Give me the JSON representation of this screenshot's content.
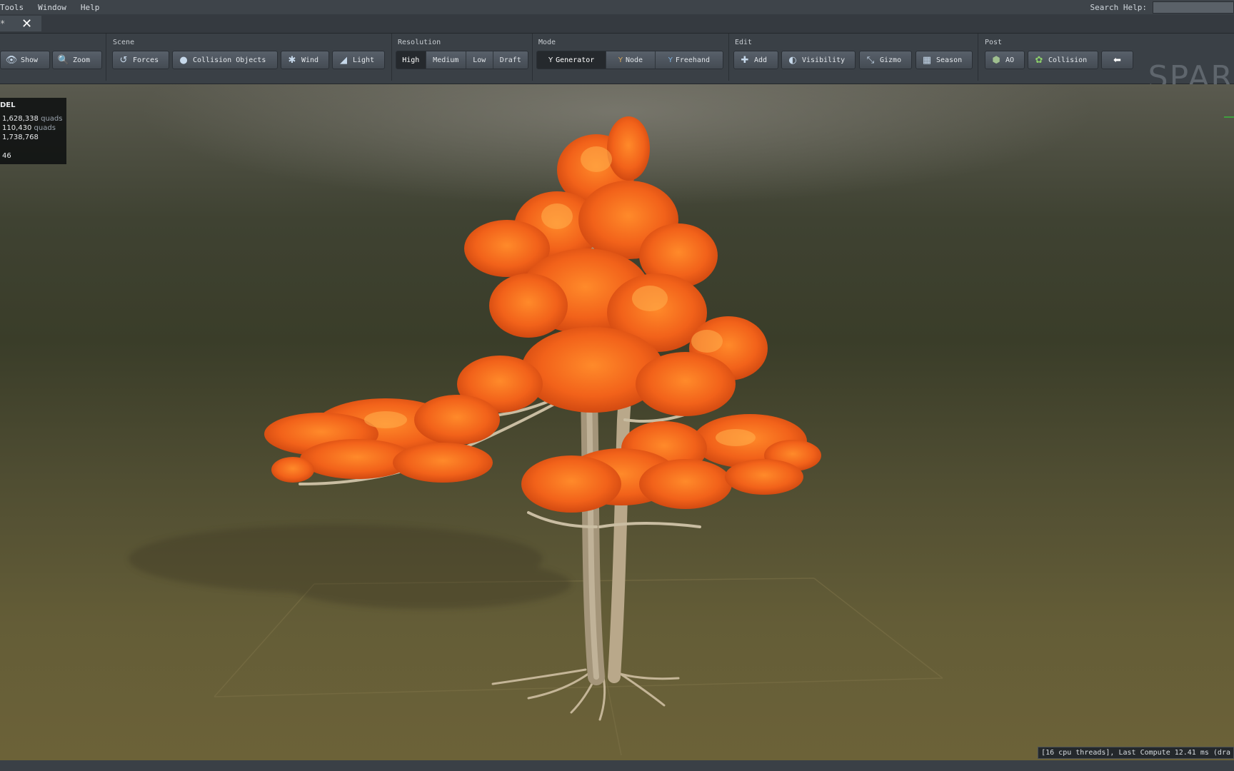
{
  "menu": [
    "Tools",
    "Window",
    "Help"
  ],
  "search": {
    "label": "Search Help:",
    "value": ""
  },
  "doc_tab": {
    "modified_mark": "*",
    "close_icon": "close-icon"
  },
  "toolbar": {
    "view": {
      "show": "Show",
      "zoom": "Zoom"
    },
    "scene": {
      "label": "Scene",
      "forces": "Forces",
      "collision_objects": "Collision Objects",
      "wind": "Wind",
      "light": "Light"
    },
    "resolution": {
      "label": "Resolution",
      "options": [
        "High",
        "Medium",
        "Low",
        "Draft"
      ],
      "selected": "High"
    },
    "mode": {
      "label": "Mode",
      "generator": "Generator",
      "node": "Node",
      "freehand": "Freehand",
      "selected": "Generator"
    },
    "edit": {
      "label": "Edit",
      "add": "Add",
      "visibility": "Visibility",
      "gizmo": "Gizmo",
      "season": "Season"
    },
    "post": {
      "label": "Post",
      "ao": "AO",
      "collision": "Collision"
    }
  },
  "logo_text": "SPAR",
  "stats": {
    "title": "DEL",
    "line1_value": "1,628,338",
    "line1_unit": "quads",
    "line2_value": "110,430",
    "line2_unit": "quads",
    "line3_value": "1,738,768",
    "line4_value": "46"
  },
  "status_text": "[16 cpu threads], Last Compute 12.41 ms (dra",
  "colors": {
    "foliage": "#f2621a",
    "trunk": "#b9a88a",
    "toolbar_bg": "#3a4046",
    "active_segment": "#25292d"
  }
}
